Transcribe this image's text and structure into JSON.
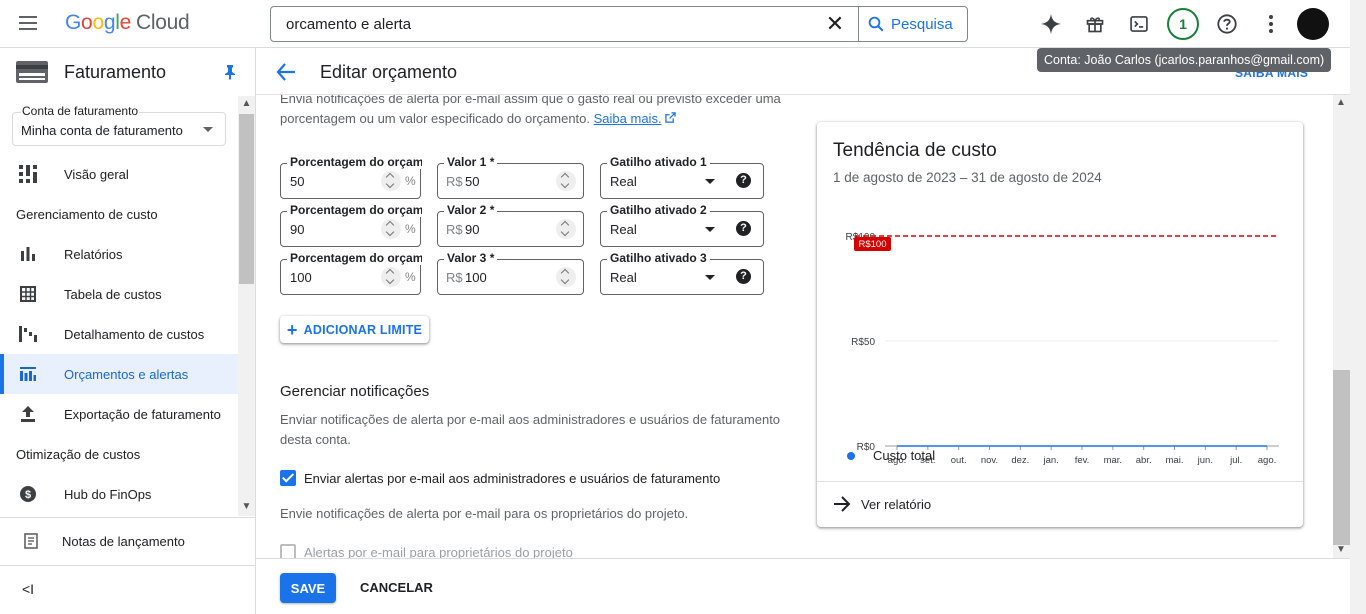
{
  "topbar": {
    "logo_google": [
      "G",
      "o",
      "o",
      "g",
      "l",
      "e"
    ],
    "logo_cloud": "Cloud",
    "search_value": "orcamento e alerta",
    "search_button": "Pesquisa",
    "notification_count": "1",
    "account_tooltip": "Conta: João Carlos (jcarlos.paranhos@gmail.com)"
  },
  "sidebar": {
    "title": "Faturamento",
    "account_label": "Conta de faturamento",
    "account_value": "Minha conta de faturamento",
    "items": [
      {
        "label": "Visão geral"
      },
      {
        "label": "Gerenciamento de custo"
      },
      {
        "label": "Relatórios"
      },
      {
        "label": "Tabela de custos"
      },
      {
        "label": "Detalhamento de custos"
      },
      {
        "label": "Orçamentos e alertas"
      },
      {
        "label": "Exportação de faturamento"
      },
      {
        "label": "Otimização de custos"
      },
      {
        "label": "Hub do FinOps"
      }
    ],
    "notes": "Notas de lançamento",
    "collapse": "<I"
  },
  "header": {
    "title": "Editar orçamento",
    "learn_more": "SAIBA MAIS"
  },
  "intro": {
    "text": "Envia notificações de alerta por e-mail assim que o gasto real ou previsto exceder uma porcentagem ou um valor especificado do orçamento.",
    "link": "Saiba mais."
  },
  "thresholds": [
    {
      "pct_label": "Porcentagem do orçamento *",
      "pct": "50",
      "amt_label": "Valor 1 *",
      "amt": "50",
      "trig_label": "Gatilho ativado 1",
      "trig": "Real"
    },
    {
      "pct_label": "Porcentagem do orçamento *",
      "pct": "90",
      "amt_label": "Valor 2 *",
      "amt": "90",
      "trig_label": "Gatilho ativado 2",
      "trig": "Real"
    },
    {
      "pct_label": "Porcentagem do orçamento *",
      "pct": "100",
      "amt_label": "Valor 3 *",
      "amt": "100",
      "trig_label": "Gatilho ativado 3",
      "trig": "Real"
    }
  ],
  "currency_prefix": "R$",
  "percent_suffix": "%",
  "add_threshold": "ADICIONAR LIMITE",
  "notifications": {
    "title": "Gerenciar notificações",
    "desc": "Enviar notificações de alerta por e-mail aos administradores e usuários de faturamento desta conta.",
    "checkbox1": "Enviar alertas por e-mail aos administradores e usuários de faturamento",
    "desc2": "Envie notificações de alerta por e-mail para os proprietários do projeto.",
    "checkbox2": "Alertas por e-mail para proprietários do projeto"
  },
  "card": {
    "title": "Tendência de custo",
    "subtitle": "1 de agosto de 2023 – 31 de agosto de 2024",
    "link": "Ver relatório"
  },
  "chart_data": {
    "type": "line",
    "x": [
      "ago.",
      "set.",
      "out.",
      "nov.",
      "dez.",
      "jan.",
      "fev.",
      "mar.",
      "abr.",
      "mai.",
      "jun.",
      "jul.",
      "ago."
    ],
    "series": [
      {
        "name": "Custo total",
        "values": [
          0,
          0,
          0,
          0,
          0,
          0,
          0,
          0,
          0,
          0,
          0,
          0,
          0
        ],
        "color": "#1a73e8"
      }
    ],
    "budget_line": {
      "value": 100,
      "label": "R$100",
      "color": "#d50000"
    },
    "y_ticks": [
      "R$0",
      "R$50",
      "R$100"
    ],
    "ylim": [
      0,
      100
    ]
  },
  "footer": {
    "save": "SAVE",
    "cancel": "CANCELAR"
  },
  "colors": {
    "accent": "#1a73e8",
    "badge": "#188038",
    "budget": "#d50000"
  }
}
